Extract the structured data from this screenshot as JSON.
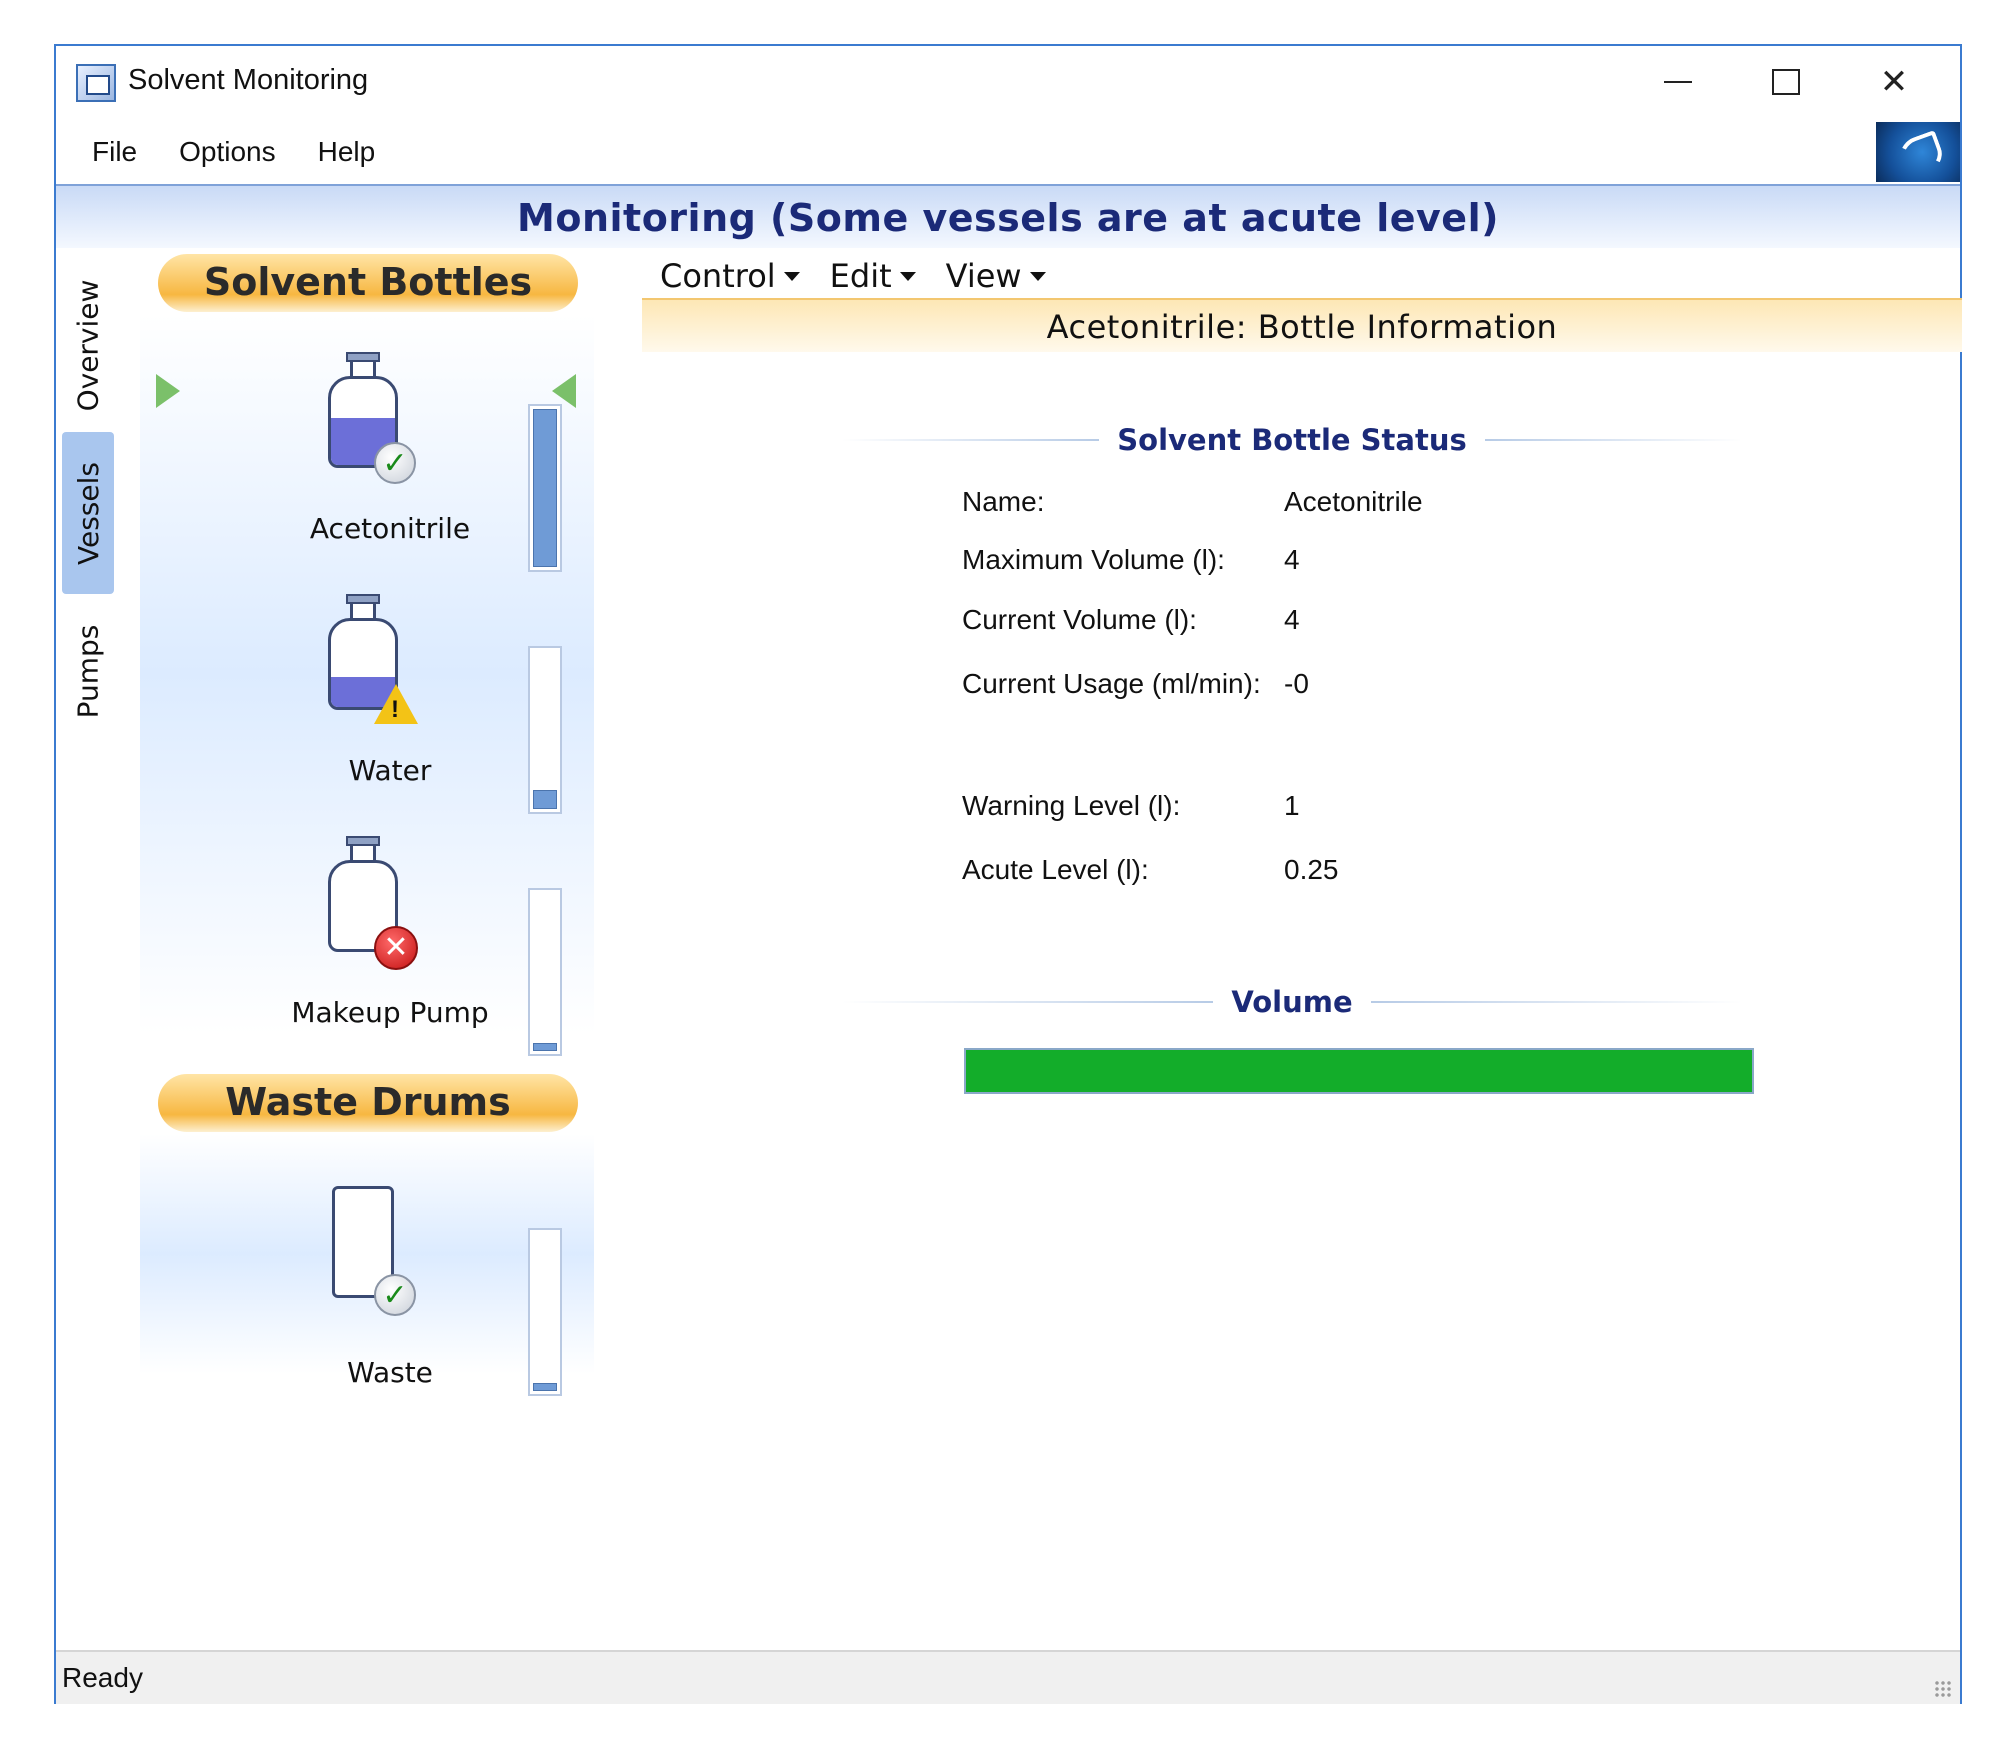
{
  "window": {
    "title": "Solvent Monitoring",
    "controls": [
      "minimize",
      "maximize",
      "close"
    ]
  },
  "menu": [
    {
      "label": "File"
    },
    {
      "label": "Options"
    },
    {
      "label": "Help"
    }
  ],
  "banner": {
    "title": "Monitoring (Some vessels are at acute level)"
  },
  "tabs": [
    {
      "label": "Overview"
    },
    {
      "label": "Vessels"
    },
    {
      "label": "Pumps"
    }
  ],
  "solvent_section": {
    "title": "Solvent Bottles",
    "vessels": [
      {
        "label": "Acetonitrile",
        "status": "ok",
        "bottle_fill_fraction": 0.55,
        "level_fraction": 1.0
      },
      {
        "label": "Water",
        "status": "warning",
        "bottle_fill_fraction": 0.35,
        "level_fraction": 0.12
      },
      {
        "label": "Makeup Pump",
        "status": "error",
        "bottle_fill_fraction": 0.0,
        "level_fraction": 0.05
      }
    ]
  },
  "waste_section": {
    "title": "Waste Drums",
    "vessels": [
      {
        "label": "Waste",
        "status": "ok",
        "level_fraction": 0.0
      }
    ]
  },
  "toolbar": [
    {
      "label": "Control"
    },
    {
      "label": "Edit"
    },
    {
      "label": "View"
    }
  ],
  "info": {
    "header": "Acetonitrile: Bottle Information",
    "status_group": "Solvent Bottle Status",
    "fields": [
      {
        "label": "Name:",
        "value": "Acetonitrile"
      },
      {
        "label": "Maximum Volume (l):",
        "value": "4"
      },
      {
        "label": "Current Volume (l):",
        "value": "4"
      },
      {
        "label": "Current Usage (ml/min):",
        "value": "-0"
      },
      {
        "label": "Warning Level (l):",
        "value": "1"
      },
      {
        "label": "Acute Level (l):",
        "value": "0.25"
      }
    ],
    "volume_group": "Volume",
    "volume_fraction": 1.0
  },
  "colors": {
    "accent_blue": "#1b2a78",
    "volume_green": "#13ad2a",
    "pill_orange": "#f7b741"
  },
  "status_bar": {
    "text": "Ready"
  }
}
